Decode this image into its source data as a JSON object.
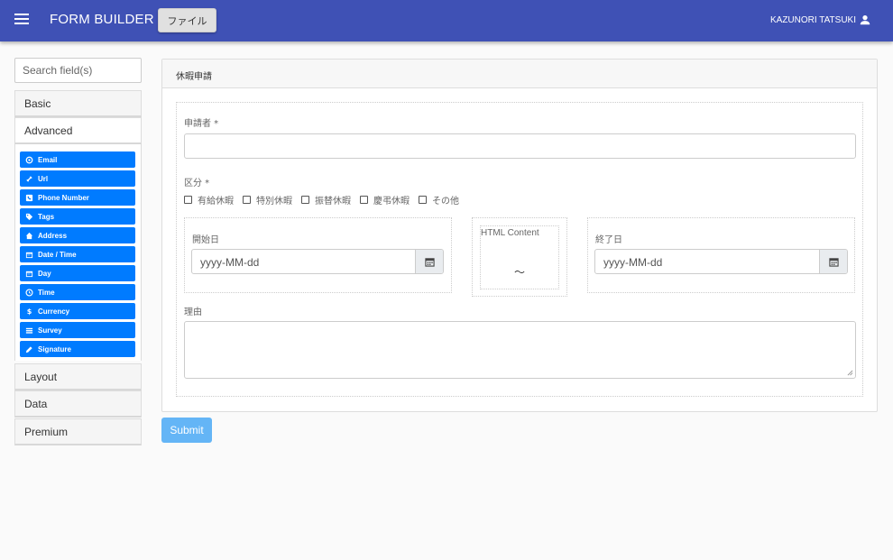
{
  "appbar": {
    "title": "FORM BUILDER",
    "file_button": "ファイル",
    "user_name": "KAZUNORI TATSUKI",
    "bg_color": "#3f51b5"
  },
  "sidebar": {
    "search_placeholder": "Search field(s)",
    "groups": [
      {
        "label": "Basic"
      },
      {
        "label": "Advanced"
      },
      {
        "label": "Layout"
      },
      {
        "label": "Data"
      },
      {
        "label": "Premium"
      }
    ],
    "advanced_components": [
      {
        "label": "Email",
        "icon": "at-icon"
      },
      {
        "label": "Url",
        "icon": "link-icon"
      },
      {
        "label": "Phone Number",
        "icon": "phone-icon"
      },
      {
        "label": "Tags",
        "icon": "tags-icon"
      },
      {
        "label": "Address",
        "icon": "home-icon"
      },
      {
        "label": "Date / Time",
        "icon": "calendar-icon"
      },
      {
        "label": "Day",
        "icon": "calendar-icon"
      },
      {
        "label": "Time",
        "icon": "clock-icon"
      },
      {
        "label": "Currency",
        "icon": "dollar-icon"
      },
      {
        "label": "Survey",
        "icon": "list-icon"
      },
      {
        "label": "Signature",
        "icon": "pencil-icon"
      }
    ],
    "button_color": "#007bff"
  },
  "form": {
    "panel_title": "休暇申請",
    "applicant_label": "申請者 *",
    "category_label": "区分 *",
    "category_options": [
      "有給休暇",
      "特別休暇",
      "振替休暇",
      "慶弔休暇",
      "その他"
    ],
    "start_date_label": "開始日",
    "start_date_placeholder": "yyyy-MM-dd",
    "html_content_label": "HTML Content",
    "html_content_text": "～",
    "end_date_label": "終了日",
    "end_date_placeholder": "yyyy-MM-dd",
    "reason_label": "理由",
    "submit_label": "Submit",
    "submit_color": "#64b5f6"
  }
}
